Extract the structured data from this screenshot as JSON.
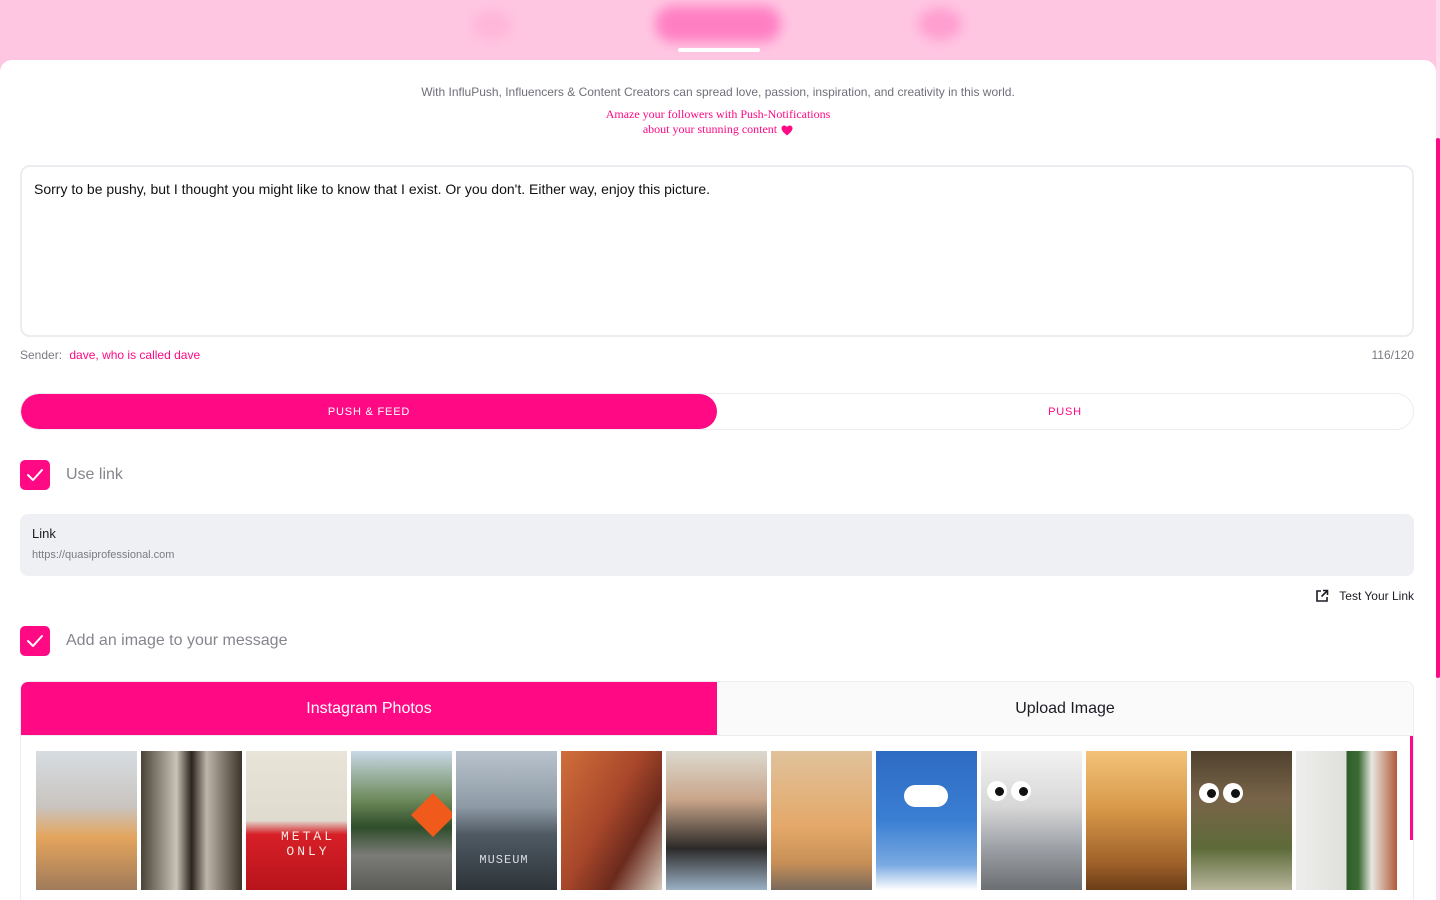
{
  "header": {
    "tagline": "With InfluPush, Influencers & Content Creators can spread love, passion, inspiration, and creativity in this world.",
    "subtag_line1": "Amaze your followers with Push-Notifications",
    "subtag_line2": "about your stunning content"
  },
  "message": {
    "text": "Sorry to be pushy, but I thought you might like to know that I exist. Or you don't. Either way, enjoy this picture.",
    "sender_label": "Sender:",
    "sender_name": "dave, who is called dave",
    "counter": "116/120"
  },
  "mode": {
    "options": [
      "PUSH & FEED",
      "PUSH"
    ],
    "selected": "PUSH & FEED"
  },
  "use_link": {
    "label": "Use link",
    "checked": true
  },
  "link": {
    "label": "Link",
    "value": "https://quasiprofessional.com"
  },
  "test_link": {
    "label": "Test Your Link"
  },
  "add_image": {
    "label": "Add an image to your message",
    "checked": true
  },
  "photo_tabs": {
    "instagram": "Instagram Photos",
    "upload": "Upload Image",
    "selected": "Instagram Photos"
  },
  "thumbs": {
    "t3_line1": "METAL",
    "t3_line2": "ONLY",
    "t5_sign": "MUSEUM"
  },
  "colors": {
    "accent": "#ff0a84",
    "header_bg": "#ffc6e2",
    "field_bg": "#eff0f3"
  }
}
